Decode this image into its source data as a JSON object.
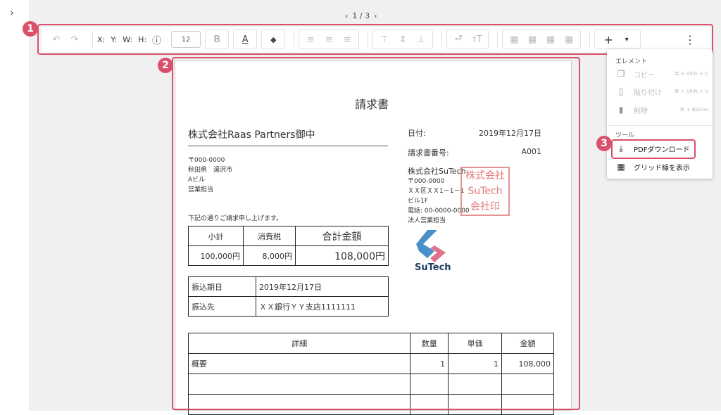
{
  "sidebar": {
    "toggle_icon": "chevron-right-icon",
    "toggle_glyph": "›"
  },
  "pager": {
    "prev": "‹",
    "label": "1 / 3",
    "next": "›"
  },
  "toolbar": {
    "undo": "↶",
    "redo": "↷",
    "x_label": "X:",
    "y_label": "Y:",
    "w_label": "W:",
    "h_label": "H:",
    "info": "ⓘ",
    "font_size": "12",
    "bold": "B",
    "text_color": "A",
    "fill": "◆",
    "align_left": "≡",
    "align_center": "≡",
    "align_right": "≡",
    "valign_top": "⊤",
    "valign_middle": "⇕",
    "valign_bottom": "⊥",
    "wrap": "⮐",
    "fit_text": "тT",
    "grid1": "▦",
    "grid2": "▦",
    "grid3": "▦",
    "grid4": "▦",
    "add": "+",
    "add_dropdown": "▾",
    "more": "⋮"
  },
  "callouts": {
    "one": "1",
    "two": "2",
    "three": "3",
    "color": "#d9506a"
  },
  "invoice": {
    "title": "請求書",
    "recipient": "株式会社Raas Partners御中",
    "recipient_address": [
      "〒000-0000",
      "秋田県　湯沢市",
      "Aビル",
      "営業担当"
    ],
    "greeting": "下記の通りご請求申し上げます。",
    "date_label": "日付:",
    "date_value": "2019年12月17日",
    "number_label": "請求書番号:",
    "number_value": "A001",
    "company": {
      "name": "株式会社SuTech",
      "lines": [
        "〒000-0000",
        "ＸＸ区ＸＸ1－1－1",
        "ビル1F",
        "電話: 00-0000-0000",
        "法人営業担当"
      ]
    },
    "seal_lines": [
      "株式会社",
      "SuTech",
      "会社印"
    ],
    "logo_text": "SuTech",
    "summary": {
      "headers": [
        "小計",
        "消費税",
        "合計金額"
      ],
      "values": [
        "100,000円",
        "8,000円",
        "108,000円"
      ]
    },
    "payment": {
      "due_label": "振込期日",
      "due_value": "2019年12月17日",
      "bank_label": "振込先",
      "bank_value": "ＸＸ銀行ＹＹ支店1111111"
    },
    "details": {
      "headers": [
        "詳細",
        "数量",
        "単価",
        "金額"
      ],
      "row1": [
        "概要",
        "1",
        "1",
        "108,000"
      ]
    }
  },
  "context_menu": {
    "section_element": "エレメント",
    "copy": {
      "label": "コピー",
      "shortcut": "⌘ + Shift + C",
      "icon": "copy-icon"
    },
    "paste": {
      "label": "貼り付け",
      "shortcut": "⌘ + Shift + V",
      "icon": "paste-icon"
    },
    "delete": {
      "label": "削除",
      "shortcut": "⌘ + BS/Del",
      "icon": "trash-icon"
    },
    "section_tools": "ツール",
    "pdf": {
      "label": "PDFダウンロード",
      "icon": "download-icon"
    },
    "grid": {
      "label": "グリッド線を表示",
      "icon": "grid-icon"
    }
  }
}
